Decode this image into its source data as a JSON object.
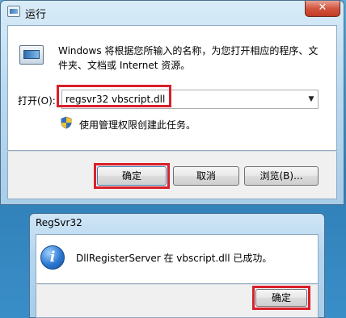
{
  "run_dialog": {
    "title": "运行",
    "close_glyph": "✕",
    "description": "Windows 将根据您所输入的名称，为您打开相应的程序、文件夹、文档或 Internet 资源。",
    "open_label": "打开(O):",
    "open_value": "regsvr32 vbscript.dll",
    "admin_note": "使用管理权限创建此任务。",
    "buttons": {
      "ok": "确定",
      "cancel": "取消",
      "browse": "浏览(B)..."
    },
    "icons": {
      "title": "run-window-icon",
      "app": "run-app-icon",
      "shield": "uac-shield-icon"
    }
  },
  "regsvr_dialog": {
    "title": "RegSvr32",
    "message": "DllRegisterServer 在 vbscript.dll 已成功。",
    "ok_label": "确定",
    "icon": "info-icon"
  },
  "highlight_color": "#d8202a"
}
